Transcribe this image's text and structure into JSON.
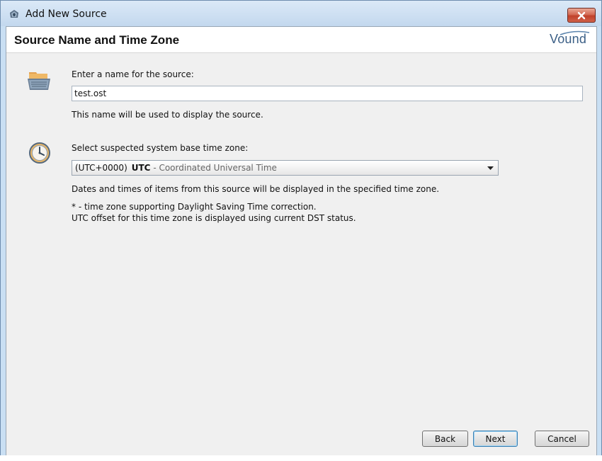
{
  "window": {
    "title": "Add New Source",
    "close_icon": "close-icon"
  },
  "header": {
    "title": "Source Name and Time Zone",
    "brand": "Vound"
  },
  "name_section": {
    "icon": "folder-icon",
    "label": "Enter a name for the source:",
    "value": "test.ost",
    "help": "This name will be used to display the source."
  },
  "timezone_section": {
    "icon": "clock-icon",
    "label": "Select suspected system base time zone:",
    "selected": {
      "offset": "(UTC+0000)",
      "code": "UTC",
      "name": " - Coordinated Universal Time"
    },
    "help": "Dates and times of items from this source will be displayed in the specified time zone.",
    "note_line1": "* - time zone supporting Daylight Saving Time correction.",
    "note_line2": "UTC offset for this time zone is displayed using current DST status."
  },
  "buttons": {
    "back": "Back",
    "next": "Next",
    "cancel": "Cancel"
  }
}
